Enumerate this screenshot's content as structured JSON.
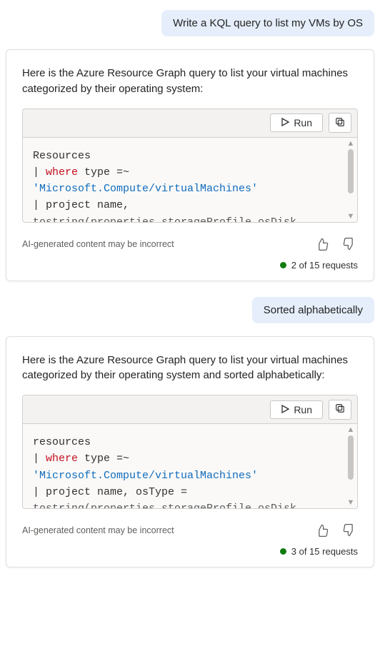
{
  "colors": {
    "accent_green": "#107c10",
    "keyword_red": "#c50f1f",
    "string_blue": "#0f6cbd"
  },
  "exchanges": [
    {
      "user_text": "Write a KQL query to list my VMs by OS",
      "assistant_intro": "Here is the Azure Resource Graph query to list your virtual machines categorized by their operating system:",
      "code": {
        "run_label": "Run",
        "line1": "Resources",
        "line2_a": "| ",
        "line2_kw": "where",
        "line2_b": " type =~",
        "line3_str": "'Microsoft.Compute/virtualMachines'",
        "line4": "| project name,",
        "line5_partial": "tostring(properties.storageProfile.osDisk"
      },
      "disclaimer": "AI-generated content may be incorrect",
      "requests_text": "2 of 15 requests"
    },
    {
      "user_text": "Sorted alphabetically",
      "assistant_intro": "Here is the Azure Resource Graph query to list your virtual machines categorized by their operating system and sorted alphabetically:",
      "code": {
        "run_label": "Run",
        "line1": "resources",
        "line2_a": "| ",
        "line2_kw": "where",
        "line2_b": " type =~",
        "line3_str": "'Microsoft.Compute/virtualMachines'",
        "line4": "| project name, osType =",
        "line5_partial": "tostring(properties.storageProfile.osDisk"
      },
      "disclaimer": "AI-generated content may be incorrect",
      "requests_text": "3 of 15 requests"
    }
  ]
}
